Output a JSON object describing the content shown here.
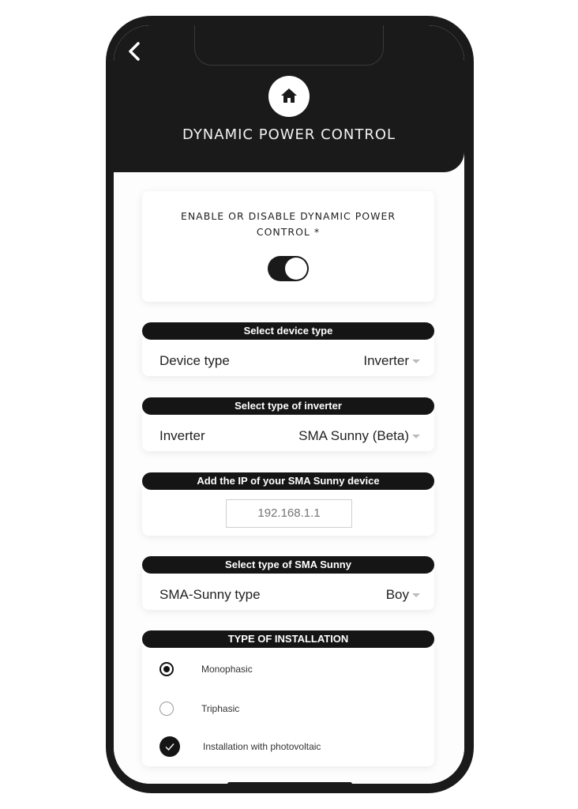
{
  "header": {
    "back_icon": "chevron-left-icon",
    "logo_icon": "home-icon",
    "title": "DYNAMIC POWER CONTROL"
  },
  "toggle_card": {
    "label": "ENABLE OR DISABLE DYNAMIC POWER CONTROL *",
    "enabled": true
  },
  "device_type": {
    "header": "Select device type",
    "label": "Device type",
    "value": "Inverter"
  },
  "inverter_type": {
    "header": "Select type of inverter",
    "label": "Inverter",
    "value": "SMA Sunny (Beta)"
  },
  "ip": {
    "header": "Add the IP of your SMA Sunny device",
    "placeholder": "192.168.1.1"
  },
  "sma_type": {
    "header": "Select type of SMA Sunny",
    "label": "SMA-Sunny type",
    "value": "Boy"
  },
  "installation": {
    "header": "TYPE OF INSTALLATION",
    "options": [
      {
        "label": "Monophasic",
        "selected": true
      },
      {
        "label": "Triphasic",
        "selected": false
      }
    ],
    "photovoltaic": {
      "label": "Installation with photovoltaic",
      "checked": true
    }
  }
}
